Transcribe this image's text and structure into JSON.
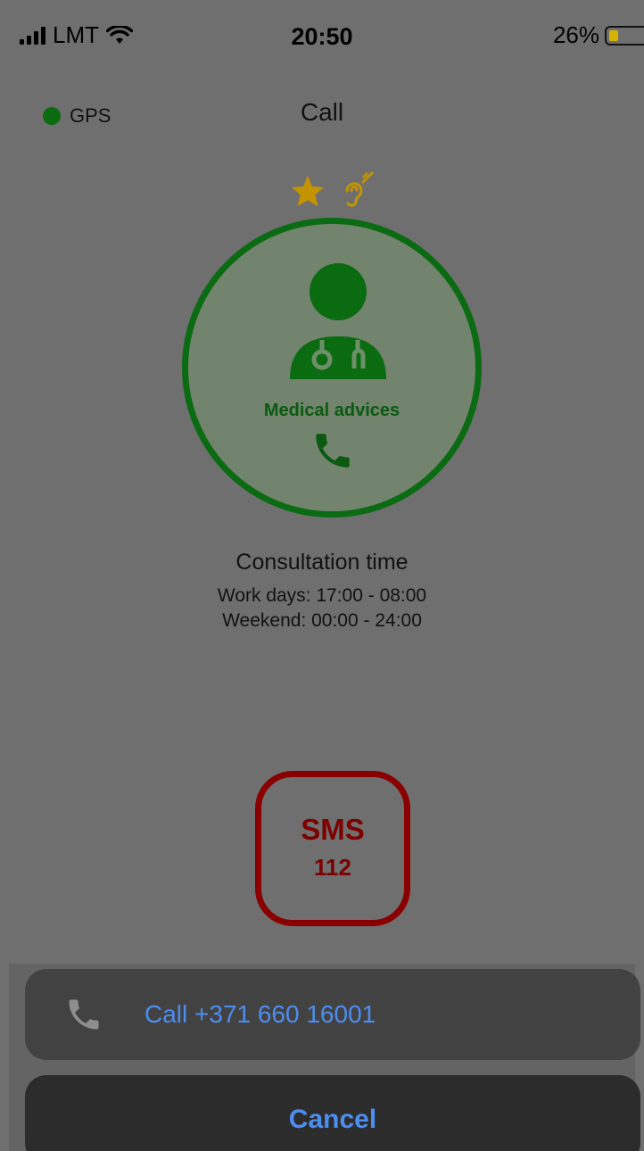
{
  "status_bar": {
    "carrier": "LMT",
    "time": "20:50",
    "battery": "26%"
  },
  "header": {
    "gps_label": "GPS",
    "title": "Call"
  },
  "service": {
    "label": "Medical advices",
    "icons": [
      "star-icon",
      "hearing-impaired-icon",
      "doctor-icon",
      "phone-icon"
    ]
  },
  "consultation": {
    "title": "Consultation time",
    "workdays": "Work days: 17:00 - 08:00",
    "weekend": "Weekend: 00:00 - 24:00"
  },
  "sms": {
    "label": "SMS",
    "number": "112"
  },
  "action_sheet": {
    "call_label": "Call +371 660 16001",
    "cancel_label": "Cancel"
  },
  "colors": {
    "green": "#0b6b12",
    "dark_red": "#8a0000",
    "gold": "#d4a000",
    "ios_blue": "#4c8ef0"
  }
}
